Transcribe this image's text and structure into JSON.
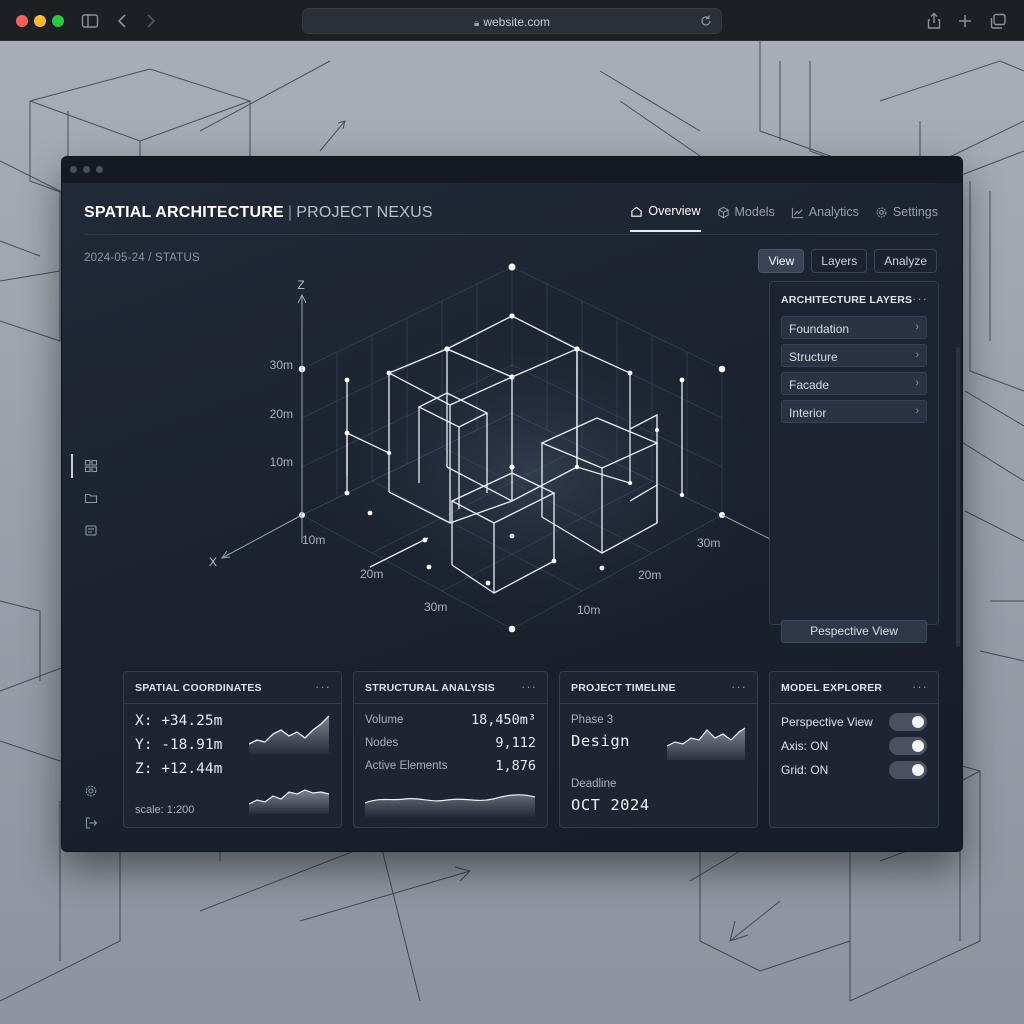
{
  "browser": {
    "url": "website.com",
    "icons": [
      "sidebar-icon",
      "back-icon",
      "forward-icon",
      "lock-icon",
      "reload-icon",
      "share-icon",
      "new-tab-icon",
      "tabs-icon"
    ]
  },
  "app": {
    "title_bold": "SPATIAL ARCHITECTURE",
    "title_separator": "|",
    "title_project": "PROJECT NEXUS",
    "nav": [
      {
        "label": "Overview",
        "icon": "home-icon",
        "active": true
      },
      {
        "label": "Models",
        "icon": "cube-icon",
        "active": false
      },
      {
        "label": "Analytics",
        "icon": "chart-icon",
        "active": false
      },
      {
        "label": "Settings",
        "icon": "gear-icon",
        "active": false
      }
    ],
    "status": "2024-05-24 / STATUS",
    "view_tabs": [
      {
        "label": "View",
        "active": true
      },
      {
        "label": "Layers",
        "active": false
      },
      {
        "label": "Analyze",
        "active": false
      }
    ],
    "rail_icons": [
      "grid-icon",
      "folder-icon",
      "layers-icon",
      "gear-icon",
      "logout-icon"
    ]
  },
  "viewport": {
    "axis_z": "Z",
    "axis_x": "X",
    "z_ticks": [
      "30m",
      "20m",
      "10m"
    ],
    "x_ticks": [
      "10m",
      "20m",
      "30m"
    ],
    "y_ticks": [
      "10m",
      "20m",
      "30m"
    ]
  },
  "layers_panel": {
    "title": "ARCHITECTURE LAYERS",
    "items": [
      "Foundation",
      "Structure",
      "Facade",
      "Interior"
    ],
    "button": "Pespective View"
  },
  "cards": {
    "coordinates": {
      "title": "SPATIAL COORDINATES",
      "x": "X: +34.25m",
      "y": "Y: -18.91m",
      "z": "Z: +12.44m",
      "scale": "scale: 1:200"
    },
    "structural": {
      "title": "STRUCTURAL ANALYSIS",
      "rows": [
        {
          "label": "Volume",
          "value": "18,450m³"
        },
        {
          "label": "Nodes",
          "value": "9,112"
        },
        {
          "label": "Active Elements",
          "value": "1,876"
        }
      ]
    },
    "timeline": {
      "title": "PROJECT TIMELINE",
      "phase_label": "Phase 3",
      "phase_value": "Design",
      "deadline_label": "Deadline",
      "deadline_value": "OCT 2024"
    },
    "explorer": {
      "title": "MODEL EXPLORER",
      "toggles": [
        {
          "label": "Perspective View",
          "on": true
        },
        {
          "label": "Axis: ON",
          "on": true
        },
        {
          "label": "Grid: ON",
          "on": true
        }
      ]
    }
  },
  "colors": {
    "app_bg": "#1b2330",
    "card_bg": "#1d2532",
    "accent": "#ffffff",
    "muted": "#8b94a2"
  }
}
